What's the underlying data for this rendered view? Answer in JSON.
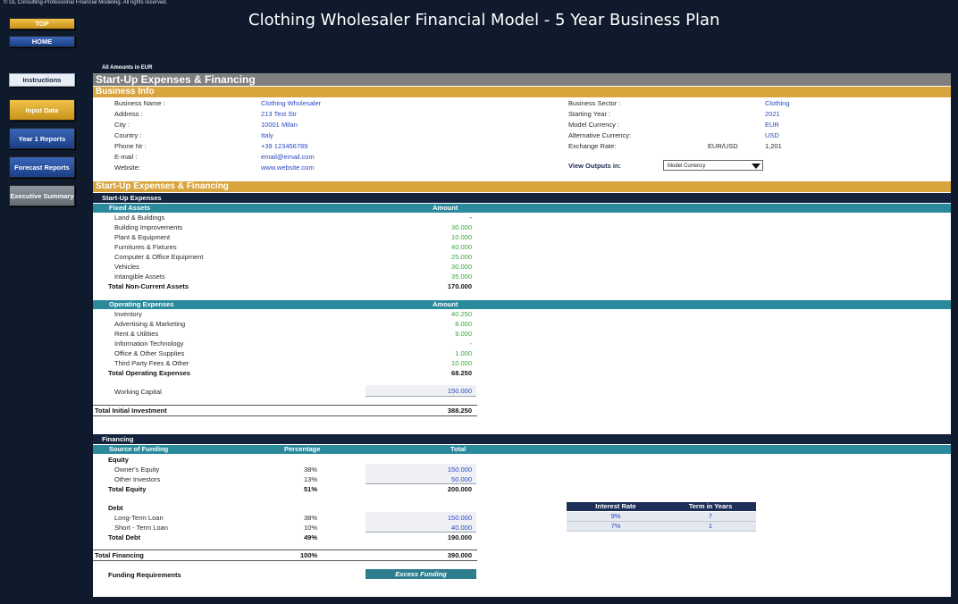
{
  "copyright": "© GL Consulting-Professional Financial Modeling. All rights reserved.",
  "title": "Clothing Wholesaler Financial Model - 5 Year Business Plan",
  "nav": {
    "top": "TOP",
    "home": "HOME",
    "instructions": "Instructions",
    "input_data": "Input Data",
    "year1": "Year 1 Reports",
    "forecast": "Forecast Reports",
    "executive": "Executive Summary"
  },
  "amounts_in": "All Amounts in  EUR",
  "startup_heading": "Start-Up Expenses & Financing",
  "business_info": {
    "heading": "Business Info",
    "left": [
      {
        "label": "Business Name :",
        "value": "Clothing Wholesaler"
      },
      {
        "label": "Address :",
        "value": "213 Test Str"
      },
      {
        "label": "City :",
        "value": "10001 Milan"
      },
      {
        "label": "Country :",
        "value": "Italy"
      },
      {
        "label": "Phone Nr :",
        "value": "+39 123456789"
      },
      {
        "label": "E-mail :",
        "value": "email@email.com"
      },
      {
        "label": "Website:",
        "value": "www.website.com"
      }
    ],
    "right": [
      {
        "label": "Business Sector :",
        "value": "Clothing"
      },
      {
        "label": "Starting Year :",
        "value": "2021"
      },
      {
        "label": "Model Currency :",
        "value": "EUR"
      },
      {
        "label": "Alternative Currency:",
        "value": "USD"
      },
      {
        "label": "Exchange Rate:",
        "pair": "EUR/USD",
        "value": "1,201"
      }
    ],
    "view_outputs_label": "View Outputs in:",
    "view_outputs_value": "Model Currency"
  },
  "startup_section": {
    "heading": "Start-Up Expenses & Financing",
    "sub": "Start-Up Expenses",
    "fixed_assets": {
      "header": "Fixed Assets",
      "amount_header": "Amount",
      "items": [
        {
          "label": "Land & Buildings",
          "value": "-"
        },
        {
          "label": "Building Improvements",
          "value": "30.000"
        },
        {
          "label": "Plant & Equipment",
          "value": "10.000"
        },
        {
          "label": "Furnitures & Fixtures",
          "value": "40.000"
        },
        {
          "label": "Computer & Office Equipment",
          "value": "25.000"
        },
        {
          "label": "Vehicles",
          "value": "30.000"
        },
        {
          "label": "Intangible Assets",
          "value": "35.000"
        }
      ],
      "total_label": "Total Non-Current Assets",
      "total_value": "170.000"
    },
    "operating_expenses": {
      "header": "Operating Expenses",
      "amount_header": "Amount",
      "items": [
        {
          "label": "Inventory",
          "value": "40.250"
        },
        {
          "label": "Advertising & Marketing",
          "value": "8.000"
        },
        {
          "label": "Rent & Utilities",
          "value": "9.000"
        },
        {
          "label": "Information Technology",
          "value": "-"
        },
        {
          "label": "Office & Other Supplies",
          "value": "1.000"
        },
        {
          "label": "Third Party Fees & Other",
          "value": "10.000"
        }
      ],
      "total_label": "Total Operating Expenses",
      "total_value": "68.250"
    },
    "working_capital_label": "Working Capital",
    "working_capital_value": "150.000",
    "total_investment_label": "Total Initial Investment",
    "total_investment_value": "388.250"
  },
  "financing": {
    "heading": "Financing",
    "col_source": "Source of Funding",
    "col_percentage": "Percentage",
    "col_total": "Total",
    "equity_label": "Equity",
    "owners_label": "Owner's Equity",
    "owners_pct": "38%",
    "owners_total": "150.000",
    "investors_label": "Other Investors",
    "investors_pct": "13%",
    "investors_total": "50.000",
    "total_equity_label": "Total Equity",
    "total_equity_pct": "51%",
    "total_equity_value": "200.000",
    "debt_label": "Debt",
    "long_label": "Long-Term Loan",
    "long_pct": "38%",
    "long_total": "150.000",
    "short_label": "Short - Term Loan",
    "short_pct": "10%",
    "short_total": "40.000",
    "total_debt_label": "Total Debt",
    "total_debt_pct": "49%",
    "total_debt_value": "190.000",
    "total_financing_label": "Total Financing",
    "total_financing_pct": "100%",
    "total_financing_value": "390.000",
    "funding_req_label": "Funding Requirements",
    "funding_req_value": "Excess Funding",
    "rate_header": "Interest Rate",
    "term_header": "Term in Years",
    "long_rate": "9%",
    "long_term": "7",
    "short_rate": "7%",
    "short_term": "1"
  }
}
